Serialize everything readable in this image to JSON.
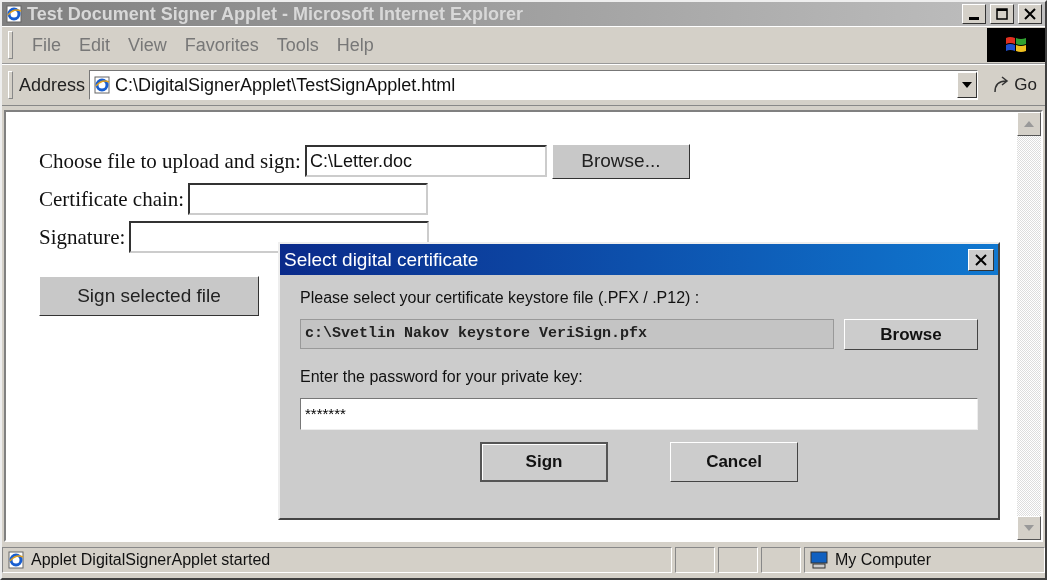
{
  "window": {
    "title": "Test Document Signer Applet - Microsoft Internet Explorer"
  },
  "menu": [
    "File",
    "Edit",
    "View",
    "Favorites",
    "Tools",
    "Help"
  ],
  "address": {
    "label": "Address",
    "url": "C:\\DigitalSignerApplet\\TestSignApplet.html",
    "go": "Go"
  },
  "page": {
    "file_label": "Choose file to upload and sign:",
    "file_value": "C:\\Letter.doc",
    "browse": "Browse...",
    "chain_label": "Certificate chain:",
    "signature_label": "Signature:",
    "sign_button": "Sign selected file"
  },
  "dialog": {
    "title": "Select digital certificate",
    "prompt": "Please select your certificate keystore file (.PFX / .P12) :",
    "keystore_path": "c:\\Svetlin Nakov keystore VeriSign.pfx",
    "browse": "Browse",
    "password_label": "Enter the password for your private key:",
    "password": "*******",
    "buttons": [
      {
        "label": "Sign",
        "default": true
      },
      {
        "label": "Cancel",
        "default": false
      }
    ]
  },
  "status_bar": {
    "message": "Applet DigitalSignerApplet started",
    "zone": "My Computer"
  }
}
